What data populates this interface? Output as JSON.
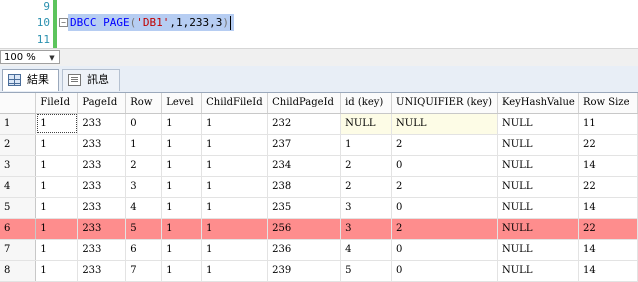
{
  "editor": {
    "line_numbers": [
      "9",
      "10",
      "11"
    ],
    "code": {
      "keyword": "DBCC PAGE",
      "open": "(",
      "db": "'DB1'",
      "rest": ",1,233,3",
      "close": ")"
    }
  },
  "status": {
    "zoom": "100 %"
  },
  "tabs": [
    {
      "label": "結果",
      "icon": "grid-results-icon"
    },
    {
      "label": "訊息",
      "icon": "messages-icon"
    }
  ],
  "grid": {
    "columns": [
      "FileId",
      "PageId",
      "Row",
      "Level",
      "ChildFileId",
      "ChildPageId",
      "id (key)",
      "UNIQUIFIER (key)",
      "KeyHashValue",
      "Row Size"
    ],
    "rows": [
      [
        "1",
        "1",
        "233",
        "0",
        "1",
        "1",
        "232",
        "NULL",
        "NULL",
        "NULL",
        "11"
      ],
      [
        "2",
        "1",
        "233",
        "1",
        "1",
        "1",
        "237",
        "1",
        "2",
        "NULL",
        "22"
      ],
      [
        "3",
        "1",
        "233",
        "2",
        "1",
        "1",
        "234",
        "2",
        "0",
        "NULL",
        "14"
      ],
      [
        "4",
        "1",
        "233",
        "3",
        "1",
        "1",
        "238",
        "2",
        "2",
        "NULL",
        "22"
      ],
      [
        "5",
        "1",
        "233",
        "4",
        "1",
        "1",
        "235",
        "3",
        "0",
        "NULL",
        "14"
      ],
      [
        "6",
        "1",
        "233",
        "5",
        "1",
        "1",
        "256",
        "3",
        "2",
        "NULL",
        "22"
      ],
      [
        "7",
        "1",
        "233",
        "6",
        "1",
        "1",
        "236",
        "4",
        "0",
        "NULL",
        "14"
      ],
      [
        "8",
        "1",
        "233",
        "7",
        "1",
        "1",
        "239",
        "5",
        "0",
        "NULL",
        "14"
      ]
    ],
    "highlight_row_index": 5,
    "highlight_color": "#fe8d8d"
  }
}
